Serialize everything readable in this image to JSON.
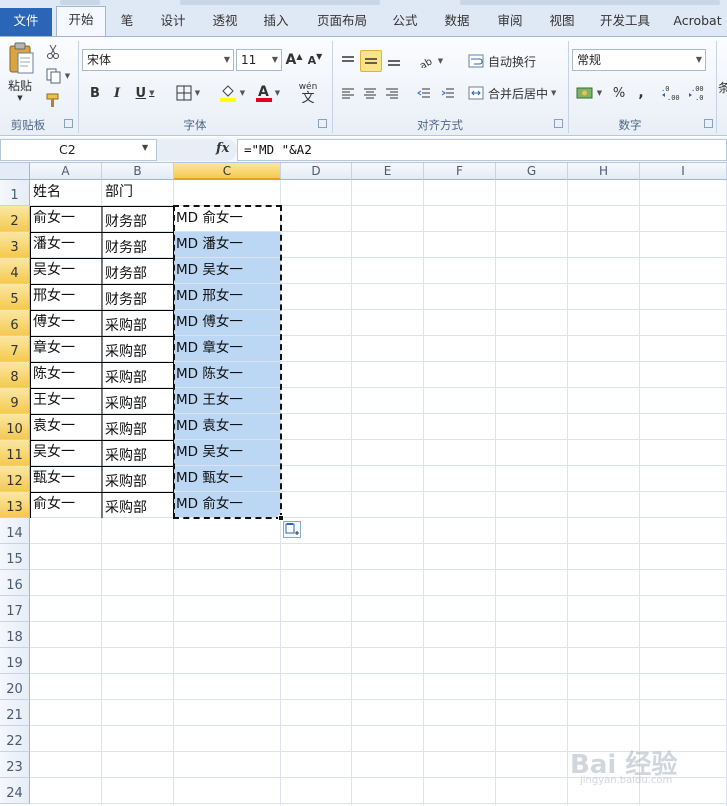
{
  "tabs": [
    {
      "label": "文件",
      "x": 0
    },
    {
      "label": "开始"
    },
    {
      "label": "笔"
    },
    {
      "label": "设计"
    },
    {
      "label": "透视"
    },
    {
      "label": "插入"
    },
    {
      "label": "页面布局"
    },
    {
      "label": "公式"
    },
    {
      "label": "数据"
    },
    {
      "label": "审阅"
    },
    {
      "label": "视图"
    },
    {
      "label": "开发工具"
    },
    {
      "label": "Acrobat"
    }
  ],
  "ribbon": {
    "clipboard": {
      "paste": "粘贴",
      "label": "剪贴板"
    },
    "font": {
      "name": "宋体",
      "size": "11",
      "label": "字体",
      "bold": "B",
      "italic": "I",
      "underline": "U",
      "grow": "A",
      "shrink": "A",
      "phonetic": "wén"
    },
    "alignment": {
      "wrap_text": "自动换行",
      "merge_center": "合并后居中",
      "label": "对齐方式"
    },
    "number": {
      "format": "常规",
      "label": "数字",
      "percent": "%",
      "comma": ","
    },
    "styles": {
      "partial": "条"
    }
  },
  "formula_bar": {
    "name_box": "C2",
    "fx": "fx",
    "formula": "=\"MD \"&A2"
  },
  "columns": [
    "A",
    "B",
    "C",
    "D",
    "E",
    "F",
    "G",
    "H",
    "I"
  ],
  "rows": [
    "1",
    "2",
    "3",
    "4",
    "5",
    "6",
    "7",
    "8",
    "9",
    "10",
    "11",
    "12",
    "13",
    "14",
    "15",
    "16",
    "17",
    "18",
    "19",
    "20",
    "21",
    "22",
    "23",
    "24"
  ],
  "table": {
    "headers": [
      "姓名",
      "部门"
    ],
    "records": [
      {
        "name": "俞女一",
        "dept": "财务部",
        "formula_result": "MD 俞女一"
      },
      {
        "name": "潘女一",
        "dept": "财务部",
        "formula_result": "MD 潘女一"
      },
      {
        "name": "吴女一",
        "dept": "财务部",
        "formula_result": "MD 吴女一"
      },
      {
        "name": "邢女一",
        "dept": "财务部",
        "formula_result": "MD 邢女一"
      },
      {
        "name": "傅女一",
        "dept": "采购部",
        "formula_result": "MD 傅女一"
      },
      {
        "name": "章女一",
        "dept": "采购部",
        "formula_result": "MD 章女一"
      },
      {
        "name": "陈女一",
        "dept": "采购部",
        "formula_result": "MD 陈女一"
      },
      {
        "name": "王女一",
        "dept": "采购部",
        "formula_result": "MD 王女一"
      },
      {
        "name": "袁女一",
        "dept": "采购部",
        "formula_result": "MD 袁女一"
      },
      {
        "name": "吴女一",
        "dept": "采购部",
        "formula_result": "MD 吴女一"
      },
      {
        "name": "甄女一",
        "dept": "采购部",
        "formula_result": "MD 甄女一"
      },
      {
        "name": "俞女一",
        "dept": "采购部",
        "formula_result": "MD 俞女一"
      }
    ]
  },
  "selected_column": "C",
  "selected_rows": [
    "2",
    "3",
    "4",
    "5",
    "6",
    "7",
    "8",
    "9",
    "10",
    "11",
    "12",
    "13"
  ],
  "watermark": {
    "text": "Bai 经验",
    "sub": "jingyan.baidu.com"
  },
  "colors": {
    "file_tab": "#2a65b8",
    "selection": "#bcd7f3",
    "header_highlight": "#f5c94e",
    "font_color_bar": "#e0001a",
    "fill_color_bar": "#ffff00"
  }
}
